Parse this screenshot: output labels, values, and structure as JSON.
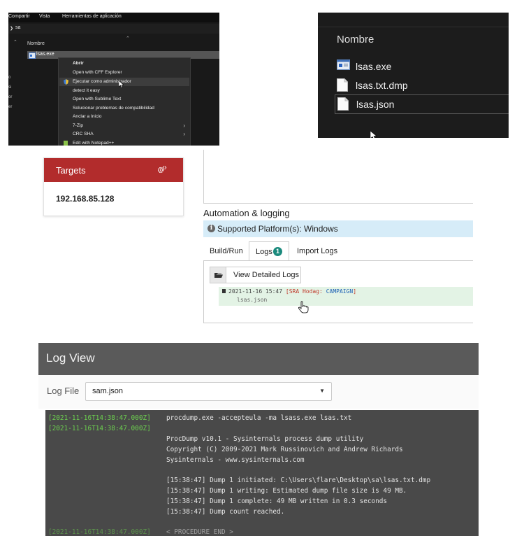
{
  "explorer": {
    "menubar": [
      "Compartir",
      "Vista",
      "Herramientas de aplicación"
    ],
    "address": "sa",
    "column_header": "Nombre",
    "file": "lsas.exe",
    "sidebar_fragments": [
      "o",
      "si",
      "or",
      "er"
    ],
    "context_menu": [
      {
        "label": "Abrir",
        "bold": true
      },
      {
        "label": "Open with CFF Explorer"
      },
      {
        "label": "Ejecutar como administrador",
        "icon": "shield-icon",
        "highlighted": true
      },
      {
        "label": "detect it easy"
      },
      {
        "label": "Open with Sublime Text"
      },
      {
        "label": "Solucionar problemas de compatibilidad"
      },
      {
        "label": "Anclar a Inicio"
      },
      {
        "label": "7-Zip",
        "submenu": true
      },
      {
        "label": "CRC SHA",
        "submenu": true
      },
      {
        "label": "Edit with Notepad++",
        "icon": "notepad-plus-plus-icon"
      }
    ]
  },
  "file_list": {
    "header": "Nombre",
    "files": [
      {
        "name": "lsas.exe",
        "icon": "exe-icon"
      },
      {
        "name": "lsas.txt.dmp",
        "icon": "document-icon"
      },
      {
        "name": "lsas.json",
        "icon": "document-icon",
        "selected": true
      }
    ]
  },
  "targets": {
    "title": "Targets",
    "header_color": "#b22c2c",
    "ip": "192.168.85.128"
  },
  "automation": {
    "title": "Automation & logging",
    "platform": "Supported Platform(s): Windows",
    "tabs": [
      "Build/Run",
      "Logs",
      "Import Logs"
    ],
    "active_tab": "Logs",
    "logs_count": "1",
    "view_button": "View Detailed Logs",
    "entry": {
      "timestamp": "2021-11-16 15:47",
      "tag_open": "[SRA Hodag:",
      "campaign": "CAMPAIGN",
      "tag_close": "]",
      "file": "lsas.json"
    }
  },
  "log_view": {
    "title": "Log View",
    "file_label": "Log File",
    "selected_file": "sam.json",
    "lines": [
      {
        "ts": "[2021-11-16T14:38:47.000Z]",
        "msg": "procdump.exe -accepteula -ma lsass.exe lsas.txt"
      },
      {
        "ts": "[2021-11-16T14:38:47.000Z]",
        "msg": ""
      },
      {
        "ts": "",
        "msg": "ProcDump v10.1 - Sysinternals process dump utility"
      },
      {
        "ts": "",
        "msg": "Copyright (C) 2009-2021 Mark Russinovich and Andrew Richards"
      },
      {
        "ts": "",
        "msg": "Sysinternals - www.sysinternals.com"
      },
      {
        "ts": "",
        "msg": ""
      },
      {
        "ts": "",
        "msg": "[15:38:47] Dump 1 initiated: C:\\Users\\flare\\Desktop\\sa\\lsas.txt.dmp"
      },
      {
        "ts": "",
        "msg": "[15:38:47] Dump 1 writing: Estimated dump file size is 49 MB."
      },
      {
        "ts": "",
        "msg": "[15:38:47] Dump 1 complete: 49 MB written in 0.3 seconds"
      },
      {
        "ts": "",
        "msg": "[15:38:47] Dump count reached."
      },
      {
        "ts": "",
        "msg": ""
      },
      {
        "ts": "[2021-11-16T14:38:47.000Z]",
        "msg": "< PROCEDURE END >",
        "faded": true
      }
    ]
  }
}
